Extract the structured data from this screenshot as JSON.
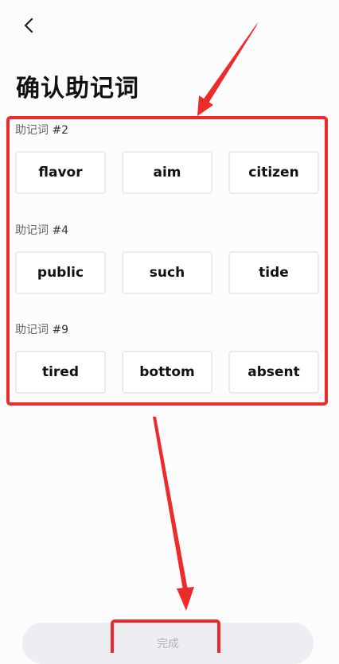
{
  "header": {
    "title": "确认助记词",
    "back_icon": "chevron-left-icon"
  },
  "groups": [
    {
      "label_prefix": "助记词",
      "label_number": "#2",
      "options": [
        "flavor",
        "aim",
        "citizen"
      ]
    },
    {
      "label_prefix": "助记词",
      "label_number": "#4",
      "options": [
        "public",
        "such",
        "tide"
      ]
    },
    {
      "label_prefix": "助记词",
      "label_number": "#9",
      "options": [
        "tired",
        "bottom",
        "absent"
      ]
    }
  ],
  "footer": {
    "done_label": "完成"
  },
  "colors": {
    "annotation": "#ee2b2b",
    "background": "#fcfbfd",
    "disabled_button": "#eeedf1"
  }
}
